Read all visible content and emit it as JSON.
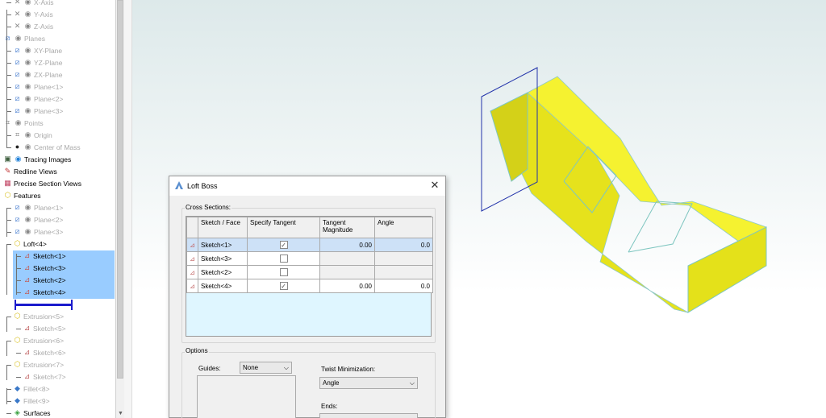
{
  "tree": {
    "items": [
      {
        "label": "X-Axis",
        "icon": "axis-icon",
        "dim": true
      },
      {
        "label": "Y-Axis",
        "icon": "axis-icon",
        "dim": true
      },
      {
        "label": "Z-Axis",
        "icon": "axis-icon",
        "dim": true
      },
      {
        "label": "Planes",
        "icon": "plane-icon",
        "dim": true
      },
      {
        "label": "XY-Plane",
        "icon": "plane-icon",
        "dim": true
      },
      {
        "label": "YZ-Plane",
        "icon": "plane-icon",
        "dim": true
      },
      {
        "label": "ZX-Plane",
        "icon": "plane-icon",
        "dim": true
      },
      {
        "label": "Plane<1>",
        "icon": "plane-icon",
        "dim": true
      },
      {
        "label": "Plane<2>",
        "icon": "plane-icon",
        "dim": true
      },
      {
        "label": "Plane<3>",
        "icon": "plane-icon",
        "dim": true
      },
      {
        "label": "Points",
        "icon": "point-icon",
        "dim": true
      },
      {
        "label": "Origin",
        "icon": "point-icon",
        "dim": true
      },
      {
        "label": "Center of Mass",
        "icon": "center-of-mass-icon",
        "dim": true
      },
      {
        "label": "Tracing Images",
        "icon": "image-icon",
        "dim": false
      },
      {
        "label": "Redline Views",
        "icon": "redline-icon",
        "dim": false
      },
      {
        "label": "Precise Section Views",
        "icon": "section-icon",
        "dim": false
      },
      {
        "label": "Features",
        "icon": "cube-icon",
        "dim": false
      },
      {
        "label": "Plane<1>",
        "icon": "plane-icon",
        "dim": true
      },
      {
        "label": "Plane<2>",
        "icon": "plane-icon",
        "dim": true
      },
      {
        "label": "Plane<3>",
        "icon": "plane-icon",
        "dim": true
      },
      {
        "label": "Loft<4>",
        "icon": "cube-icon",
        "dim": false
      },
      {
        "label": "Sketch<1>",
        "icon": "sketch-icon",
        "dim": false
      },
      {
        "label": "Sketch<3>",
        "icon": "sketch-icon",
        "dim": false
      },
      {
        "label": "Sketch<2>",
        "icon": "sketch-icon",
        "dim": false
      },
      {
        "label": "Sketch<4>",
        "icon": "sketch-icon",
        "dim": false
      },
      {
        "label": "",
        "icon": "rollback-marker-icon",
        "dim": false
      },
      {
        "label": "Extrusion<5>",
        "icon": "cube-icon",
        "dim": true
      },
      {
        "label": "Sketch<5>",
        "icon": "sketch-icon",
        "dim": true
      },
      {
        "label": "Extrusion<6>",
        "icon": "cube-icon",
        "dim": true
      },
      {
        "label": "Sketch<6>",
        "icon": "sketch-icon",
        "dim": true
      },
      {
        "label": "Extrusion<7>",
        "icon": "cube-icon",
        "dim": true
      },
      {
        "label": "Sketch<7>",
        "icon": "sketch-icon",
        "dim": true
      },
      {
        "label": "Fillet<8>",
        "icon": "fillet-icon",
        "dim": true
      },
      {
        "label": "Fillet<9>",
        "icon": "fillet-icon",
        "dim": true
      },
      {
        "label": "Surfaces",
        "icon": "surface-icon",
        "dim": false
      }
    ]
  },
  "dialog": {
    "title": "Loft Boss",
    "cross_sections_label": "Cross Sections:",
    "columns": [
      "Sketch / Face",
      "Specify Tangent",
      "Tangent Magnitude",
      "Angle"
    ],
    "rows": [
      {
        "sketch": "Sketch<1>",
        "tangent": true,
        "magnitude": "0.00",
        "angle": "0.0",
        "selected": true
      },
      {
        "sketch": "Sketch<3>",
        "tangent": false,
        "magnitude": "",
        "angle": "",
        "selected": false
      },
      {
        "sketch": "Sketch<2>",
        "tangent": false,
        "magnitude": "",
        "angle": "",
        "selected": false
      },
      {
        "sketch": "Sketch<4>",
        "tangent": true,
        "magnitude": "0.00",
        "angle": "0.0",
        "selected": false
      }
    ],
    "options_label": "Options",
    "guides_label": "Guides:",
    "guides_value": "None",
    "twist_label": "Twist Minimization:",
    "twist_value": "Angle",
    "ends_label": "Ends:"
  },
  "colors": {
    "selection": "#99ccff",
    "loft_face": "#f5f230",
    "loft_edge": "#7ec6c0",
    "plane_outline": "#2233aa",
    "grid_empty": "#dff6ff",
    "rollback_marker": "#1a1acc"
  }
}
